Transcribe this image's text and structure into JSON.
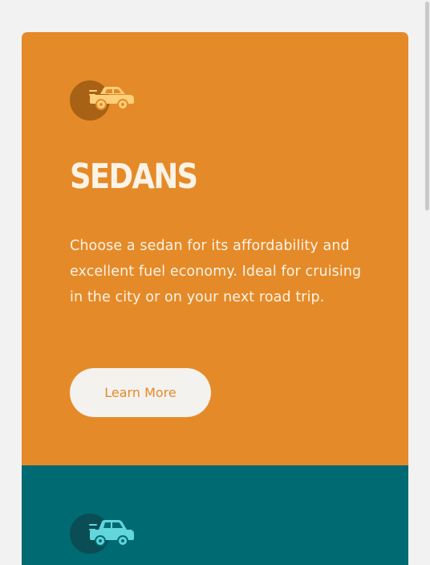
{
  "colors": {
    "page_bg": "#f2f2f2",
    "sedans_bg": "#e58a28",
    "sedans_icon_circle": "#a86215",
    "sedans_icon_car": "#ffd07a",
    "suvs_bg": "#006a72",
    "suvs_icon_circle": "#0b4d54",
    "suvs_icon_car": "#63d6dc",
    "heading_text": "#fbf3e6",
    "button_bg": "#f4f2ef",
    "button_text": "#e58a28"
  },
  "cards": [
    {
      "id": "sedans",
      "icon": "sedan-car-icon",
      "title": "SEDANS",
      "description": "Choose a sedan for its affordability and excellent fuel economy. Ideal for cruising in the city or on your next road trip.",
      "button_label": "Learn More"
    },
    {
      "id": "suvs",
      "icon": "suv-car-icon"
    }
  ]
}
